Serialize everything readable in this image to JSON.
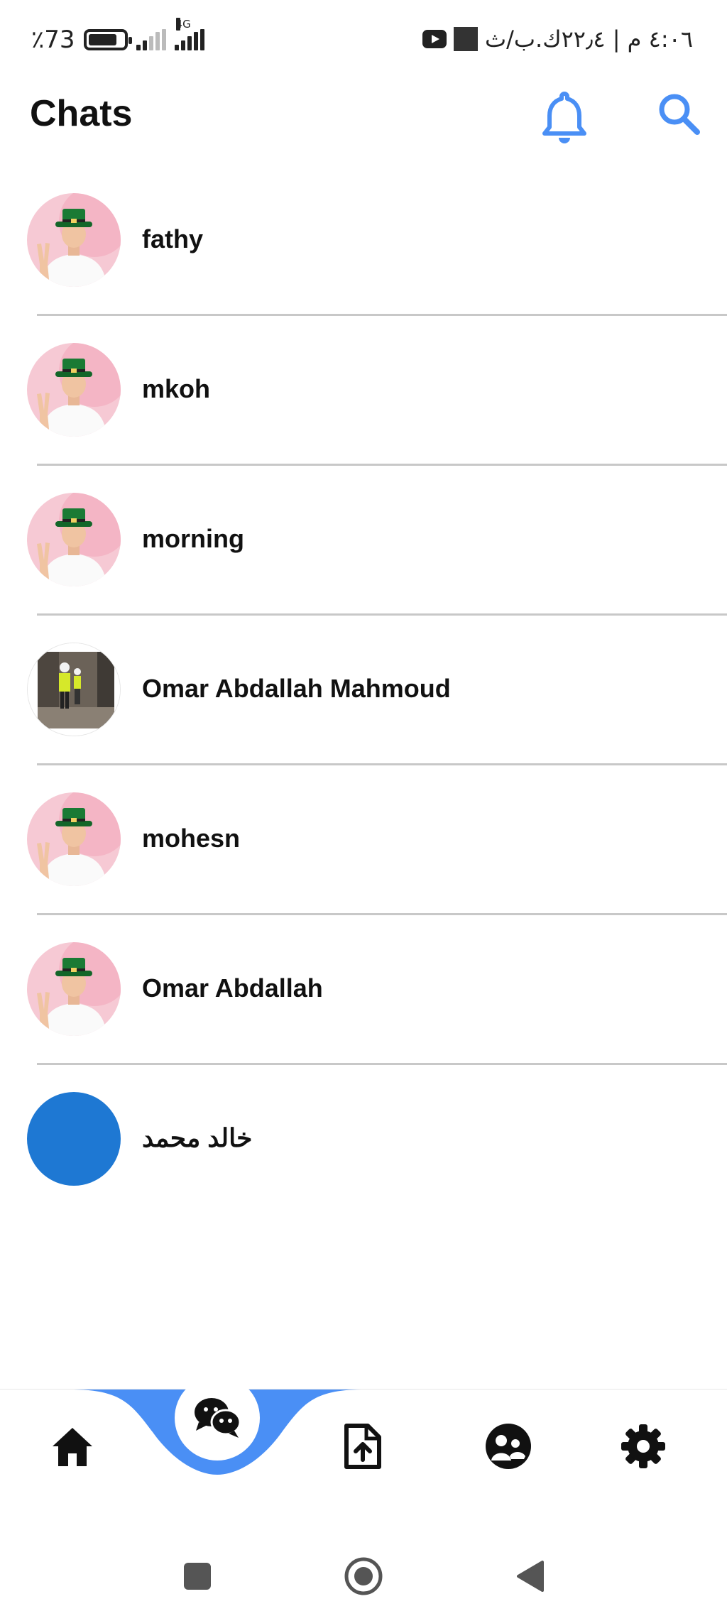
{
  "status_bar": {
    "battery_percent": "٪73",
    "battery_level": 0.73,
    "network_label": "4G",
    "time_text": "٤:٠٦ م | ٢٢٫٤ك.ب/ث"
  },
  "header": {
    "title": "Chats",
    "notification_icon": "bell-icon",
    "search_icon": "search-icon"
  },
  "chats": [
    {
      "name": "fathy",
      "avatar": "person-green-hat"
    },
    {
      "name": "mkoh",
      "avatar": "person-green-hat"
    },
    {
      "name": "morning",
      "avatar": "person-green-hat"
    },
    {
      "name": "Omar Abdallah Mahmoud",
      "avatar": "construction-photo"
    },
    {
      "name": "mohesn",
      "avatar": "person-green-hat"
    },
    {
      "name": "Omar Abdallah",
      "avatar": "person-green-hat"
    },
    {
      "name": "خالد محمد",
      "avatar": "blue-circle"
    }
  ],
  "bottom_nav": {
    "items": [
      "home-icon",
      "chats-icon",
      "file-upload-icon",
      "community-icon",
      "settings-icon"
    ],
    "active": "chats-icon"
  },
  "system_nav": [
    "recent-apps-icon",
    "home-circle-icon",
    "back-icon"
  ],
  "colors": {
    "accent": "#4a8ff5",
    "nav_curve": "#4a8ff5",
    "avatar_blue": "#1e78d3",
    "divider": "#c8c8c8",
    "text": "#111111"
  }
}
